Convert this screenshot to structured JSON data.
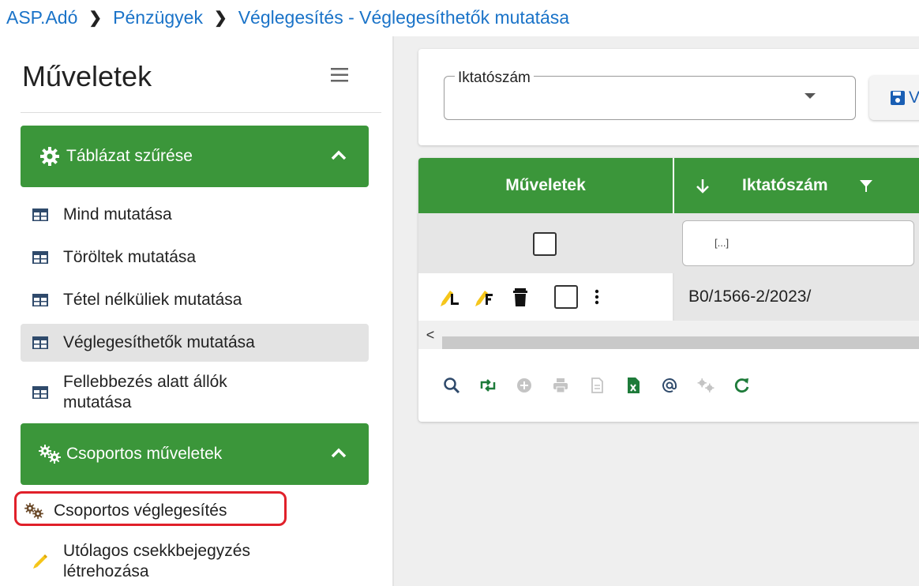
{
  "breadcrumb": {
    "items": [
      "ASP.Adó",
      "Pénzügyek",
      "Véglegesítés - Véglegesíthetők mutatása"
    ],
    "separator": ">"
  },
  "sidebar": {
    "title": "Műveletek",
    "groups": [
      {
        "label": "Táblázat szűrése",
        "icon": "gear-icon",
        "items": [
          {
            "label": "Mind mutatása",
            "icon": "table-icon"
          },
          {
            "label": "Töröltek mutatása",
            "icon": "table-icon"
          },
          {
            "label": "Tétel nélküliek mutatása",
            "icon": "table-icon"
          },
          {
            "label": "Véglegesíthetők mutatása",
            "icon": "table-icon",
            "active": true
          },
          {
            "label": "Fellebbezés alatt állók mutatása",
            "icon": "table-icon"
          }
        ]
      },
      {
        "label": "Csoportos műveletek",
        "icon": "gears-icon",
        "items": [
          {
            "label": "Csoportos véglegesítés",
            "icon": "gears-icon",
            "highlighted": true
          },
          {
            "label": "Utólagos csekkbejegyzés létrehozása",
            "icon": "pencil-icon"
          }
        ]
      }
    ]
  },
  "filter": {
    "select_label": "Iktatószám",
    "select_value": "",
    "save_button_label": "V"
  },
  "table": {
    "columns": [
      "Műveletek",
      "Iktatószám"
    ],
    "filter_placeholder": "[...]",
    "rows": [
      {
        "iktatoszam": "B0/1566-2/2023/"
      }
    ],
    "scroll_left_glyph": "<"
  },
  "toolbar": {
    "icons": [
      "search-icon",
      "swap-icon",
      "add-icon",
      "print-icon",
      "document-icon",
      "excel-icon",
      "email-icon",
      "settings-icon",
      "refresh-icon"
    ]
  },
  "colors": {
    "accent_green": "#3b963a",
    "link_blue": "#1a73c8",
    "highlight_red": "#e0202a"
  }
}
